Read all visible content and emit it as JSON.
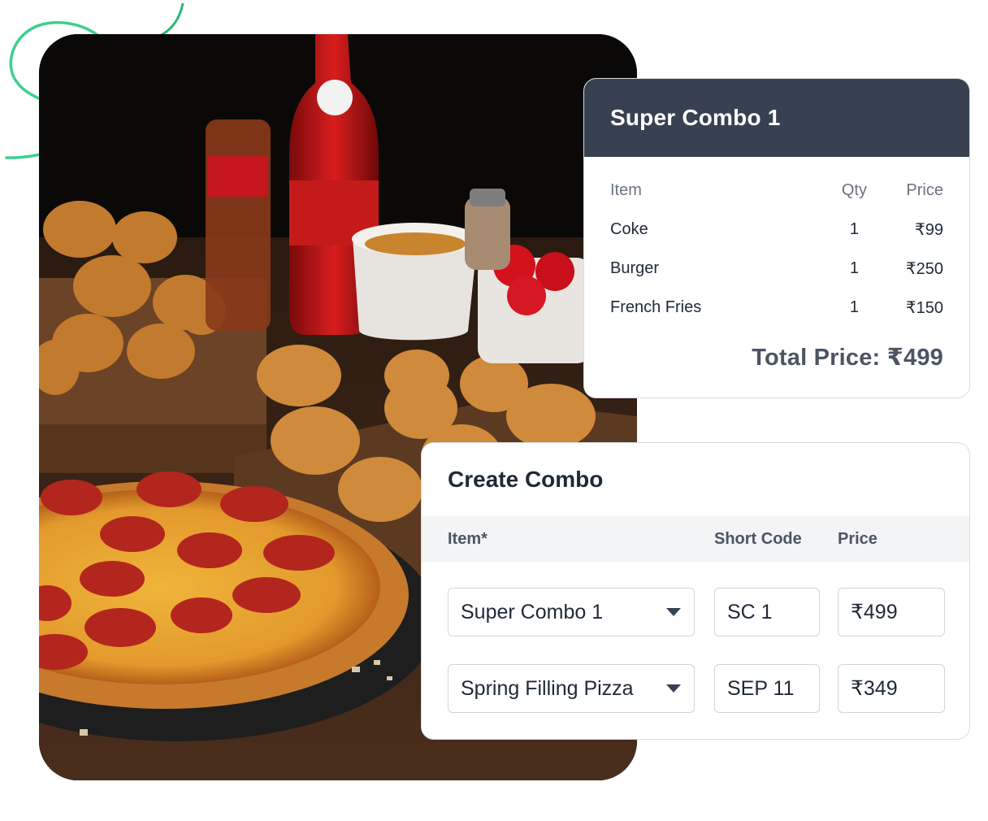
{
  "combo_card": {
    "title": "Super Combo 1",
    "headers": {
      "item": "Item",
      "qty": "Qty",
      "price": "Price"
    },
    "rows": [
      {
        "item": "Coke",
        "qty": "1",
        "price": "₹99"
      },
      {
        "item": "Burger",
        "qty": "1",
        "price": "₹250"
      },
      {
        "item": "French Fries",
        "qty": "1",
        "price": "₹150"
      }
    ],
    "total": "Total Price: ₹499"
  },
  "create_combo": {
    "title": "Create Combo",
    "headers": {
      "item": "Item*",
      "short_code": "Short Code",
      "price": "Price"
    },
    "rows": [
      {
        "item": "Super Combo 1",
        "short_code": "SC 1",
        "price": "₹499"
      },
      {
        "item": "Spring Filling Pizza",
        "short_code": "SEP 11",
        "price": "₹349"
      }
    ]
  },
  "colors": {
    "card_header_bg": "#374151",
    "accent_ring": "#3ecf8e",
    "table_header_bg": "#f3f4f6"
  },
  "icons": {
    "dropdown": "chevron-down-icon"
  }
}
